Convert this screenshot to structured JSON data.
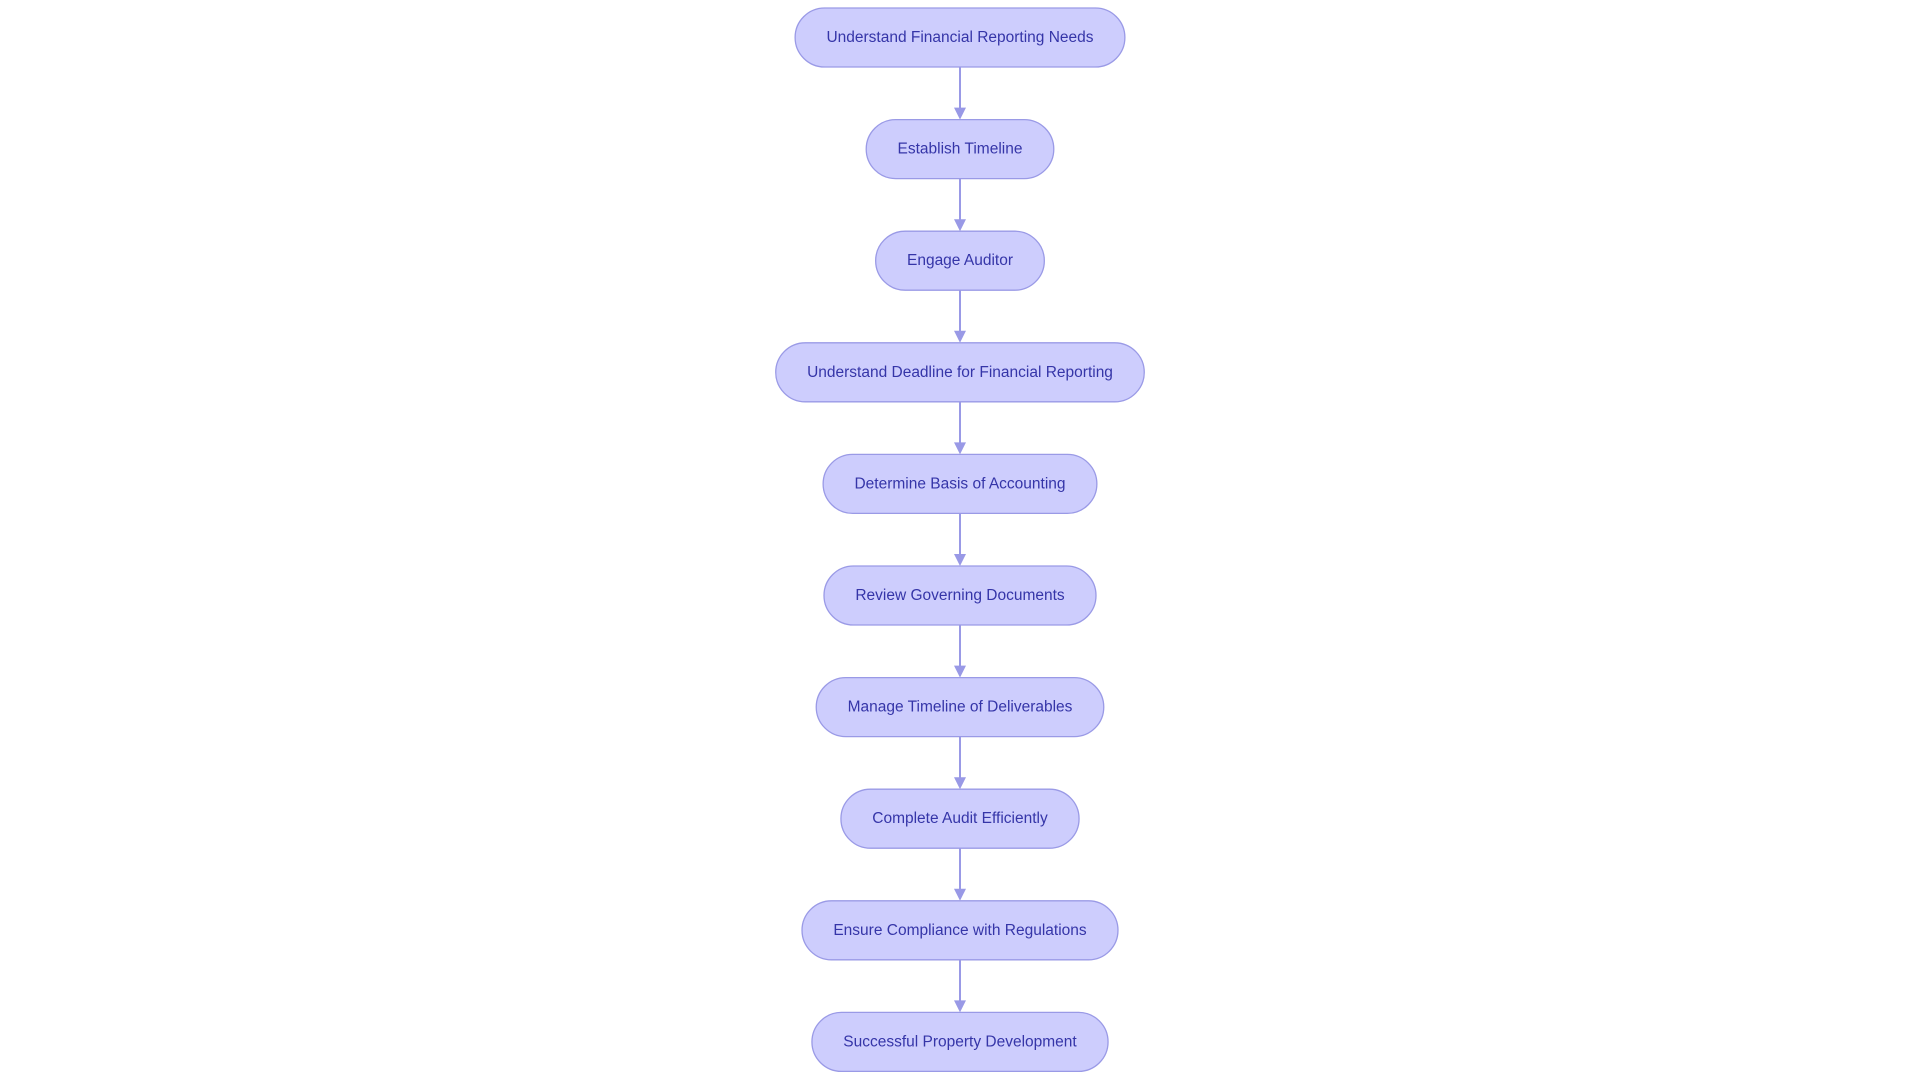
{
  "diagram": {
    "type": "flowchart",
    "direction": "top-to-bottom",
    "colors": {
      "node_fill": "#cdcdfd",
      "node_stroke": "#9a9ae6",
      "node_text": "#3535a8",
      "edge": "#9999e6",
      "background": "#ffffff"
    },
    "nodes": [
      {
        "id": "n1",
        "label": "Understand Financial Reporting Needs"
      },
      {
        "id": "n2",
        "label": "Establish Timeline"
      },
      {
        "id": "n3",
        "label": "Engage Auditor"
      },
      {
        "id": "n4",
        "label": "Understand Deadline for Financial Reporting"
      },
      {
        "id": "n5",
        "label": "Determine Basis of Accounting"
      },
      {
        "id": "n6",
        "label": "Review Governing Documents"
      },
      {
        "id": "n7",
        "label": "Manage Timeline of Deliverables"
      },
      {
        "id": "n8",
        "label": "Complete Audit Efficiently"
      },
      {
        "id": "n9",
        "label": "Ensure Compliance with Regulations"
      },
      {
        "id": "n10",
        "label": "Successful Property Development"
      }
    ],
    "edges": [
      {
        "from": "n1",
        "to": "n2"
      },
      {
        "from": "n2",
        "to": "n3"
      },
      {
        "from": "n3",
        "to": "n4"
      },
      {
        "from": "n4",
        "to": "n5"
      },
      {
        "from": "n5",
        "to": "n6"
      },
      {
        "from": "n6",
        "to": "n7"
      },
      {
        "from": "n7",
        "to": "n8"
      },
      {
        "from": "n8",
        "to": "n9"
      },
      {
        "from": "n9",
        "to": "n10"
      }
    ]
  }
}
